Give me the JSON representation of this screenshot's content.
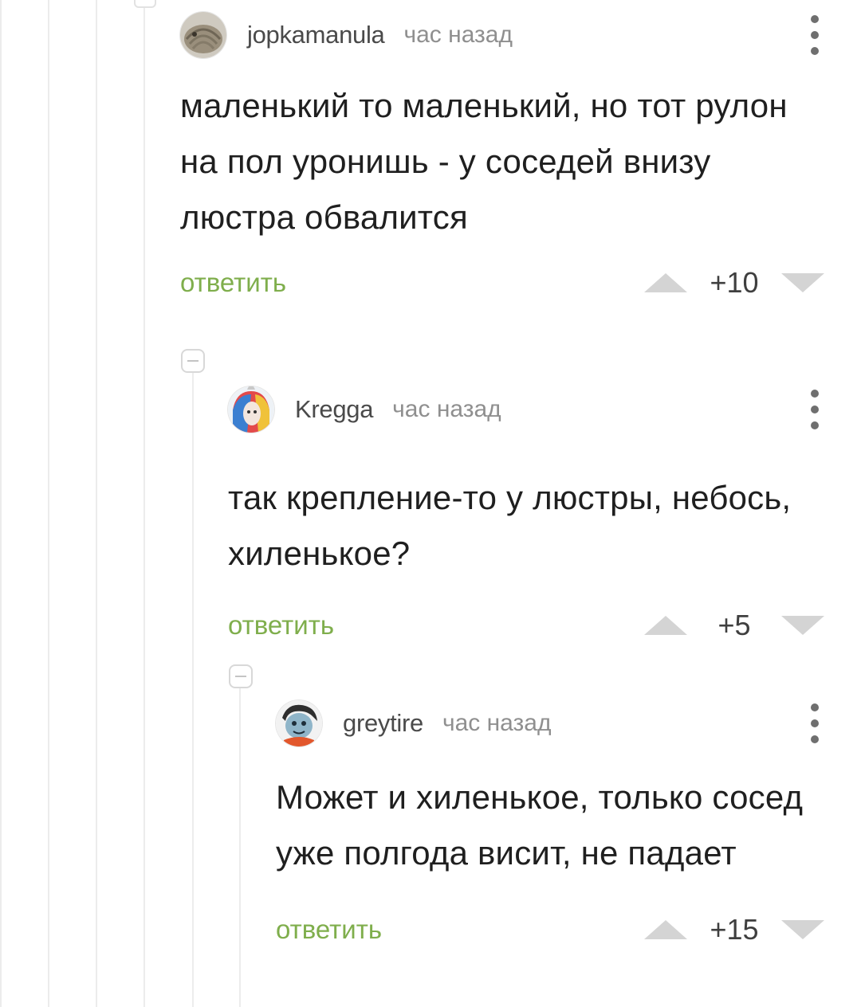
{
  "comments": [
    {
      "username": "jopkamanula",
      "time": "час назад",
      "body": "маленький то маленький, но тот рулон на пол уронишь - у соседей внизу люстра обвалится",
      "reply_label": "ответить",
      "score": "+10",
      "avatar_icon": "pangolin-avatar"
    },
    {
      "username": "Kregga",
      "time": "час назад",
      "body": "так крепление-то у люстры, небось, хиленькое?",
      "reply_label": "ответить",
      "score": "+5",
      "avatar_icon": "anime-character-avatar"
    },
    {
      "username": "greytire",
      "time": "час назад",
      "body": "Может и хиленькое, только сосед уже полгода висит, не падает",
      "reply_label": "ответить",
      "score": "+15",
      "avatar_icon": "cartoon-face-avatar"
    }
  ],
  "colors": {
    "reply_green": "#7fae4c",
    "text": "#1f1f1f",
    "meta": "#8f8f8f",
    "vote_arrow": "#d4d4d4"
  }
}
